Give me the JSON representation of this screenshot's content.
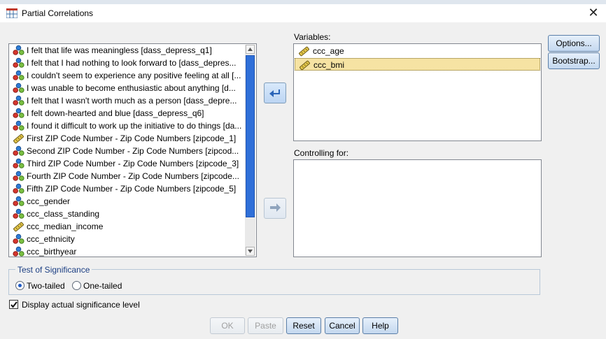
{
  "window": {
    "title": "Partial Correlations",
    "close_glyph": "✕"
  },
  "source_list": [
    {
      "label": "I felt that life was meaningless [dass_depress_q1]",
      "icon": "nominal-icon"
    },
    {
      "label": "I felt that I had nothing to look forward to [dass_depres...",
      "icon": "nominal-icon"
    },
    {
      "label": "I couldn't seem to experience any positive feeling at all [...",
      "icon": "nominal-icon"
    },
    {
      "label": "I was unable to become enthusiastic about anything [d...",
      "icon": "nominal-icon"
    },
    {
      "label": "I felt that I wasn't worth much as a person [dass_depre...",
      "icon": "nominal-icon"
    },
    {
      "label": "I felt down-hearted and blue [dass_depress_q6]",
      "icon": "nominal-icon"
    },
    {
      "label": "I found it difficult to work up the initiative to do things [da...",
      "icon": "nominal-icon"
    },
    {
      "label": "First ZIP Code Number - Zip Code Numbers [zipcode_1]",
      "icon": "scale-ruler-icon"
    },
    {
      "label": "Second ZIP Code Number - Zip Code Numbers [zipcod...",
      "icon": "nominal-icon"
    },
    {
      "label": "Third ZIP Code Number - Zip Code Numbers [zipcode_3]",
      "icon": "nominal-icon"
    },
    {
      "label": "Fourth ZIP Code Number - Zip Code Numbers [zipcode...",
      "icon": "nominal-icon"
    },
    {
      "label": "Fifth ZIP Code Number - Zip Code Numbers [zipcode_5]",
      "icon": "nominal-icon"
    },
    {
      "label": "ccc_gender",
      "icon": "nominal-icon"
    },
    {
      "label": "ccc_class_standing",
      "icon": "nominal-icon"
    },
    {
      "label": "ccc_median_income",
      "icon": "scale-ruler-icon"
    },
    {
      "label": "ccc_ethnicity",
      "icon": "nominal-icon"
    },
    {
      "label": "ccc_birthyear",
      "icon": "nominal-icon"
    }
  ],
  "variables": {
    "label": "Variables:",
    "items": [
      {
        "label": "ccc_age",
        "selected": false,
        "icon": "scale-ruler-icon"
      },
      {
        "label": "ccc_bmi",
        "selected": true,
        "icon": "scale-ruler-icon"
      }
    ]
  },
  "controlling": {
    "label": "Controlling for:",
    "items": []
  },
  "side_buttons": {
    "options": "Options...",
    "bootstrap": "Bootstrap..."
  },
  "significance": {
    "legend": "Test of Significance",
    "two_tailed": "Two-tailed",
    "one_tailed": "One-tailed",
    "selected": "Two-tailed"
  },
  "display_actual": {
    "label": "Display actual significance level",
    "checked": true
  },
  "footer": {
    "ok": "OK",
    "paste": "Paste",
    "reset": "Reset",
    "cancel": "Cancel",
    "help": "Help"
  },
  "colors": {
    "accent": "#2f6fd8",
    "selection": "#f6e3a3",
    "legend_text": "#1c3f83"
  }
}
